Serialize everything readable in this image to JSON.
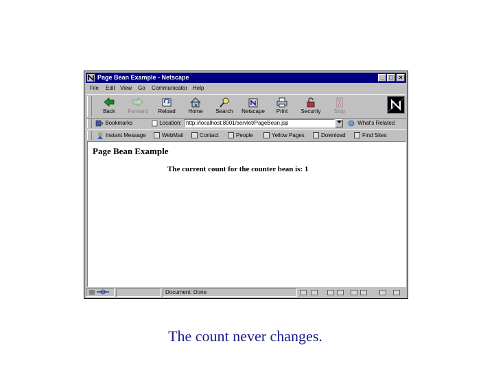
{
  "window": {
    "title": "Page Bean Example - Netscape",
    "minimize": "_",
    "maximize": "□",
    "close": "×"
  },
  "menu": [
    "File",
    "Edit",
    "View",
    "Go",
    "Communicator",
    "Help"
  ],
  "toolbar": {
    "buttons": [
      {
        "label": "Back",
        "icon": "back-arrow-icon",
        "enabled": true
      },
      {
        "label": "Forward",
        "icon": "forward-arrow-icon",
        "enabled": false
      },
      {
        "label": "Reload",
        "icon": "reload-icon",
        "enabled": true
      },
      {
        "label": "Home",
        "icon": "home-icon",
        "enabled": true
      },
      {
        "label": "Search",
        "icon": "search-icon",
        "enabled": true
      },
      {
        "label": "Netscape",
        "icon": "netscape-icon",
        "enabled": true
      },
      {
        "label": "Print",
        "icon": "print-icon",
        "enabled": true
      },
      {
        "label": "Security",
        "icon": "security-icon",
        "enabled": true
      },
      {
        "label": "Stop",
        "icon": "stop-icon",
        "enabled": false
      }
    ]
  },
  "location": {
    "bookmarks_label": "Bookmarks",
    "location_label": "Location:",
    "url": "http://localhost:8001/servlet/PageBean.jsp",
    "related_label": "What's Related"
  },
  "personal_bar": [
    "Instant Message",
    "WebMail",
    "Contact",
    "People",
    "Yellow Pages",
    "Download",
    "Find Sites"
  ],
  "page": {
    "heading": "Page Bean Example",
    "message": "The current count for the counter bean is: 1"
  },
  "status": {
    "text": "Document: Done"
  },
  "caption": "The count never changes.",
  "colors": {
    "titlebar": "#000080",
    "chrome": "#c0c0c0",
    "caption": "#1a1a8c"
  }
}
